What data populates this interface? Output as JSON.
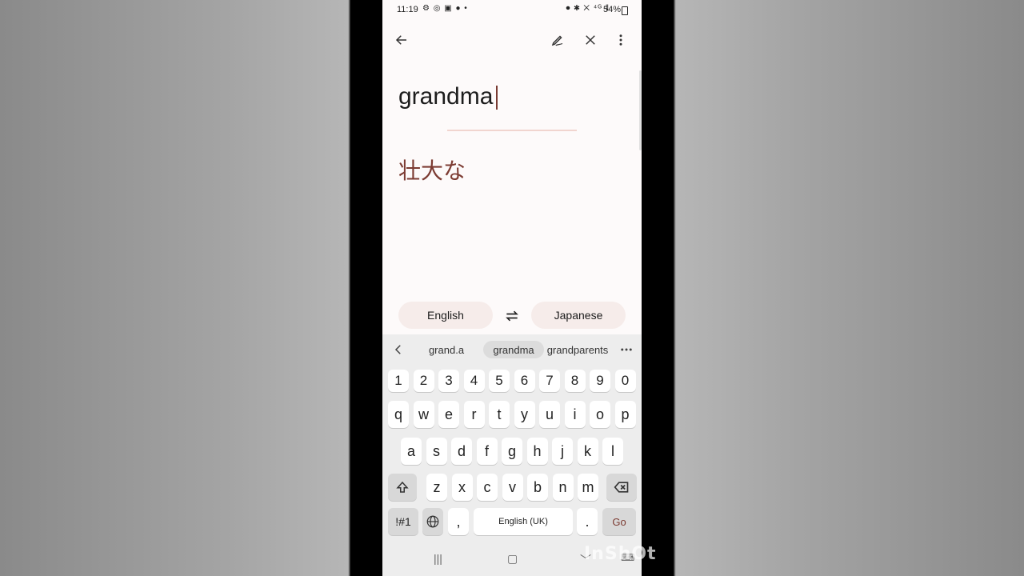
{
  "status_bar": {
    "time": "11:19",
    "battery": "54%"
  },
  "input": {
    "text": "grandma"
  },
  "output": {
    "text": "壮大な"
  },
  "languages": {
    "source": "English",
    "target": "Japanese"
  },
  "suggestions": [
    "grand.a",
    "grandma",
    "grandparents"
  ],
  "keyboard": {
    "numbers": [
      "1",
      "2",
      "3",
      "4",
      "5",
      "6",
      "7",
      "8",
      "9",
      "0"
    ],
    "row1": [
      "q",
      "w",
      "e",
      "r",
      "t",
      "y",
      "u",
      "i",
      "o",
      "p"
    ],
    "row2": [
      "a",
      "s",
      "d",
      "f",
      "g",
      "h",
      "j",
      "k",
      "l"
    ],
    "row3": [
      "z",
      "x",
      "c",
      "v",
      "b",
      "n",
      "m"
    ],
    "symbols_label": "!#1",
    "comma": ",",
    "space_label": "English (UK)",
    "period": ".",
    "go_label": "Go"
  },
  "watermark": "InShOt",
  "colors": {
    "translation": "#7c3b32",
    "caret": "#7a3b33",
    "chip": "#f6ecea"
  }
}
